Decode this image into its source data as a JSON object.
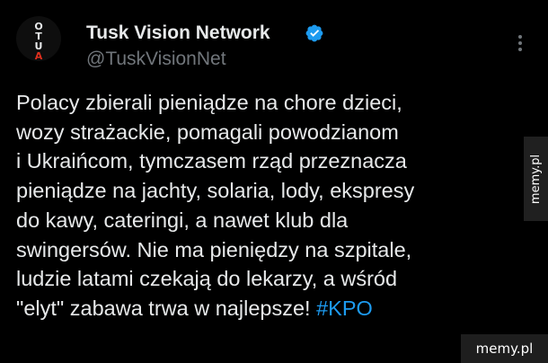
{
  "tweet": {
    "avatar_letters": [
      "O",
      "T",
      "U",
      "A"
    ],
    "author_name": "Tusk Vision Network",
    "handle": "@TuskVisionNet",
    "verified_icon": "verified-badge-icon",
    "more_icon": "more-options-icon",
    "text_lines": [
      "Polacy zbierali pieniądze na chore dzieci,",
      "wozy strażackie, pomagali powodzianom",
      "i Ukraińcom, tymczasem rząd przeznacza",
      "pieniądze na jachty, solaria, lody, ekspresy",
      "do kawy, cateringi, a nawet klub dla",
      "swingersów. Nie ma pieniędzy na szpitale,",
      "ludzie latami czekają do lekarzy, a wśród"
    ],
    "last_line_text": "\"elyt\" zabawa trwa w najlepsze! ",
    "hashtag": "#KPO"
  },
  "watermarks": {
    "side": "memy.pl",
    "bottom": "memy.pl"
  },
  "colors": {
    "background": "#000000",
    "text": "#e7e9ea",
    "secondary": "#71767b",
    "link": "#1d9bf0",
    "verified": "#1d9bf0"
  }
}
